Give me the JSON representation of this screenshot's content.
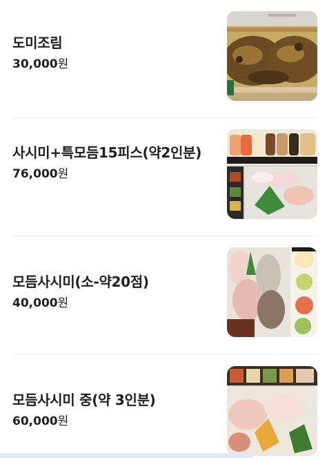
{
  "menu": {
    "items": [
      {
        "name": "도미조림",
        "price_number": "30,000",
        "price_unit": "원",
        "photo": "braised-sea-bream-photo"
      },
      {
        "name": "사시미+특모듬15피스(약2인분)",
        "price_number": "76,000",
        "price_unit": "원",
        "photo": "sashimi-sushi-combo-photo"
      },
      {
        "name": "모듬사시미(소-약20점)",
        "price_number": "40,000",
        "price_unit": "원",
        "photo": "assorted-sashimi-small-photo"
      },
      {
        "name": "모듬사시미 중(약 3인분)",
        "price_number": "60,000",
        "price_unit": "원",
        "photo": "assorted-sashimi-medium-photo"
      }
    ]
  },
  "colors": {
    "text": "#1e1e1e",
    "divider": "#eeeeee",
    "bottom_bar": "#dfe8f6"
  }
}
